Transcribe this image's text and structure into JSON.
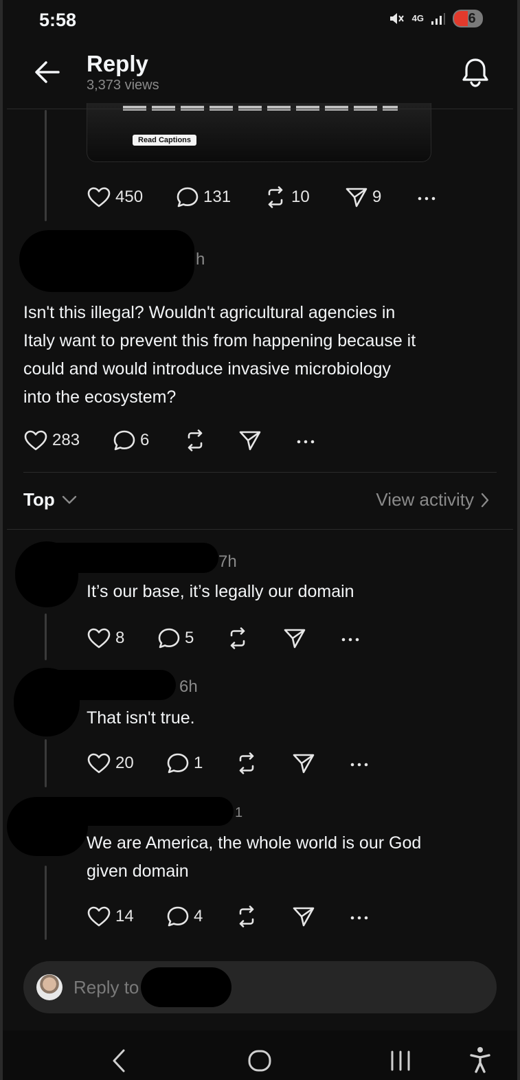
{
  "status_bar": {
    "time": "5:58",
    "network": "4G",
    "battery_level": "6",
    "battery_color": "#e23a2c"
  },
  "header": {
    "title": "Reply",
    "views": "3,373 views"
  },
  "video_card": {
    "caption_button": "Read Captions"
  },
  "main_post": {
    "likes": "450",
    "comments": "131",
    "reposts": "10",
    "shares": "9"
  },
  "reply_post": {
    "time": "h",
    "text_lines": [
      "Isn't this illegal? Wouldn't agricultural agencies in",
      "Italy want to prevent this from happening because it",
      "could and would introduce invasive microbiology",
      "into the ecosystem?"
    ],
    "likes": "283",
    "comments": "6"
  },
  "sort": {
    "label": "Top",
    "view_activity": "View activity"
  },
  "comments": [
    {
      "time": "7h",
      "text": "It’s our base, it’s legally our domain",
      "likes": "8",
      "replies": "5"
    },
    {
      "time": "6h",
      "text": "That isn't true.",
      "likes": "20",
      "replies": "1"
    },
    {
      "time": "1",
      "text_lines": [
        "We are America, the whole world is our God",
        "given domain"
      ],
      "likes": "14",
      "replies": "4"
    }
  ],
  "reply_bar": {
    "placeholder": "Reply to"
  },
  "icons": {
    "like": "heart-icon",
    "comment": "speech-bubble-icon",
    "repost": "repost-icon",
    "share": "paper-plane-icon",
    "more": "more-icon"
  }
}
